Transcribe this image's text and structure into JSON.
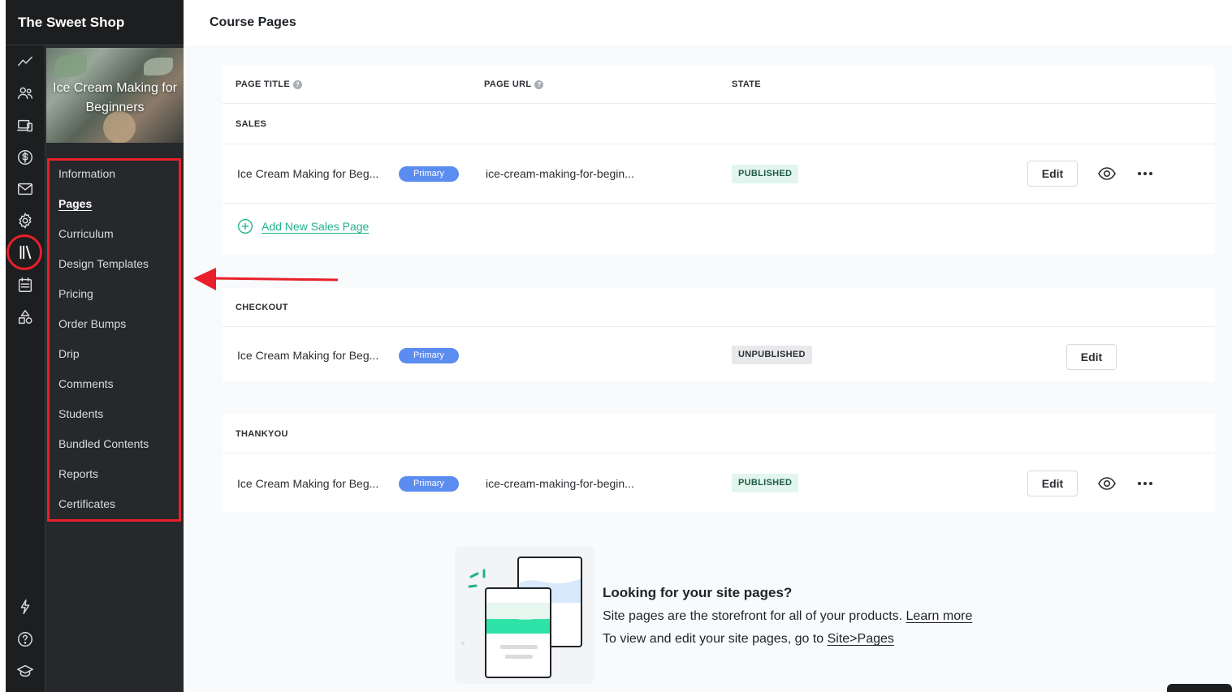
{
  "app": {
    "brand": "The Sweet Shop"
  },
  "header": {
    "title": "Course Pages"
  },
  "rail": {
    "icons": [
      "trend-icon",
      "users-icon",
      "devices-icon",
      "dollar-icon",
      "mail-icon",
      "gear-icon",
      "library-icon",
      "calendar-icon",
      "shapes-icon",
      "bolt-icon",
      "help-circle-icon",
      "graduation-cap-icon"
    ],
    "selected": "library-icon"
  },
  "course": {
    "title": "Ice Cream Making for Beginners",
    "nav": [
      {
        "label": "Information"
      },
      {
        "label": "Pages"
      },
      {
        "label": "Curriculum"
      },
      {
        "label": "Design Templates"
      },
      {
        "label": "Pricing"
      },
      {
        "label": "Order Bumps"
      },
      {
        "label": "Drip"
      },
      {
        "label": "Comments"
      },
      {
        "label": "Students"
      },
      {
        "label": "Bundled Contents"
      },
      {
        "label": "Reports"
      },
      {
        "label": "Certificates"
      }
    ],
    "active_nav": "Pages"
  },
  "table": {
    "columns": {
      "title": "PAGE TITLE",
      "url": "PAGE URL",
      "state": "STATE"
    },
    "sections": [
      {
        "name": "SALES",
        "row": {
          "title": "Ice Cream Making for Beg...",
          "badge": "Primary",
          "url": "ice-cream-making-for-begin...",
          "state": "PUBLISHED",
          "edit": "Edit"
        },
        "add_link": "Add New Sales Page"
      },
      {
        "name": "CHECKOUT",
        "row": {
          "title": "Ice Cream Making for Beg...",
          "badge": "Primary",
          "url": "",
          "state": "UNPUBLISHED",
          "edit": "Edit"
        }
      },
      {
        "name": "THANKYOU",
        "row": {
          "title": "Ice Cream Making for Beg...",
          "badge": "Primary",
          "url": "ice-cream-making-for-begin...",
          "state": "PUBLISHED",
          "edit": "Edit"
        }
      }
    ]
  },
  "promo": {
    "title": "Looking for your site pages?",
    "line1_text": "Site pages are the storefront for all of your products. ",
    "line1_link": "Learn more",
    "line2_text": "To view and edit your site pages, go to ",
    "line2_link": "Site>Pages"
  },
  "colors": {
    "accent_green": "#20b28a",
    "primary_badge": "#5b8cf0",
    "highlight_red": "#e8202b"
  }
}
